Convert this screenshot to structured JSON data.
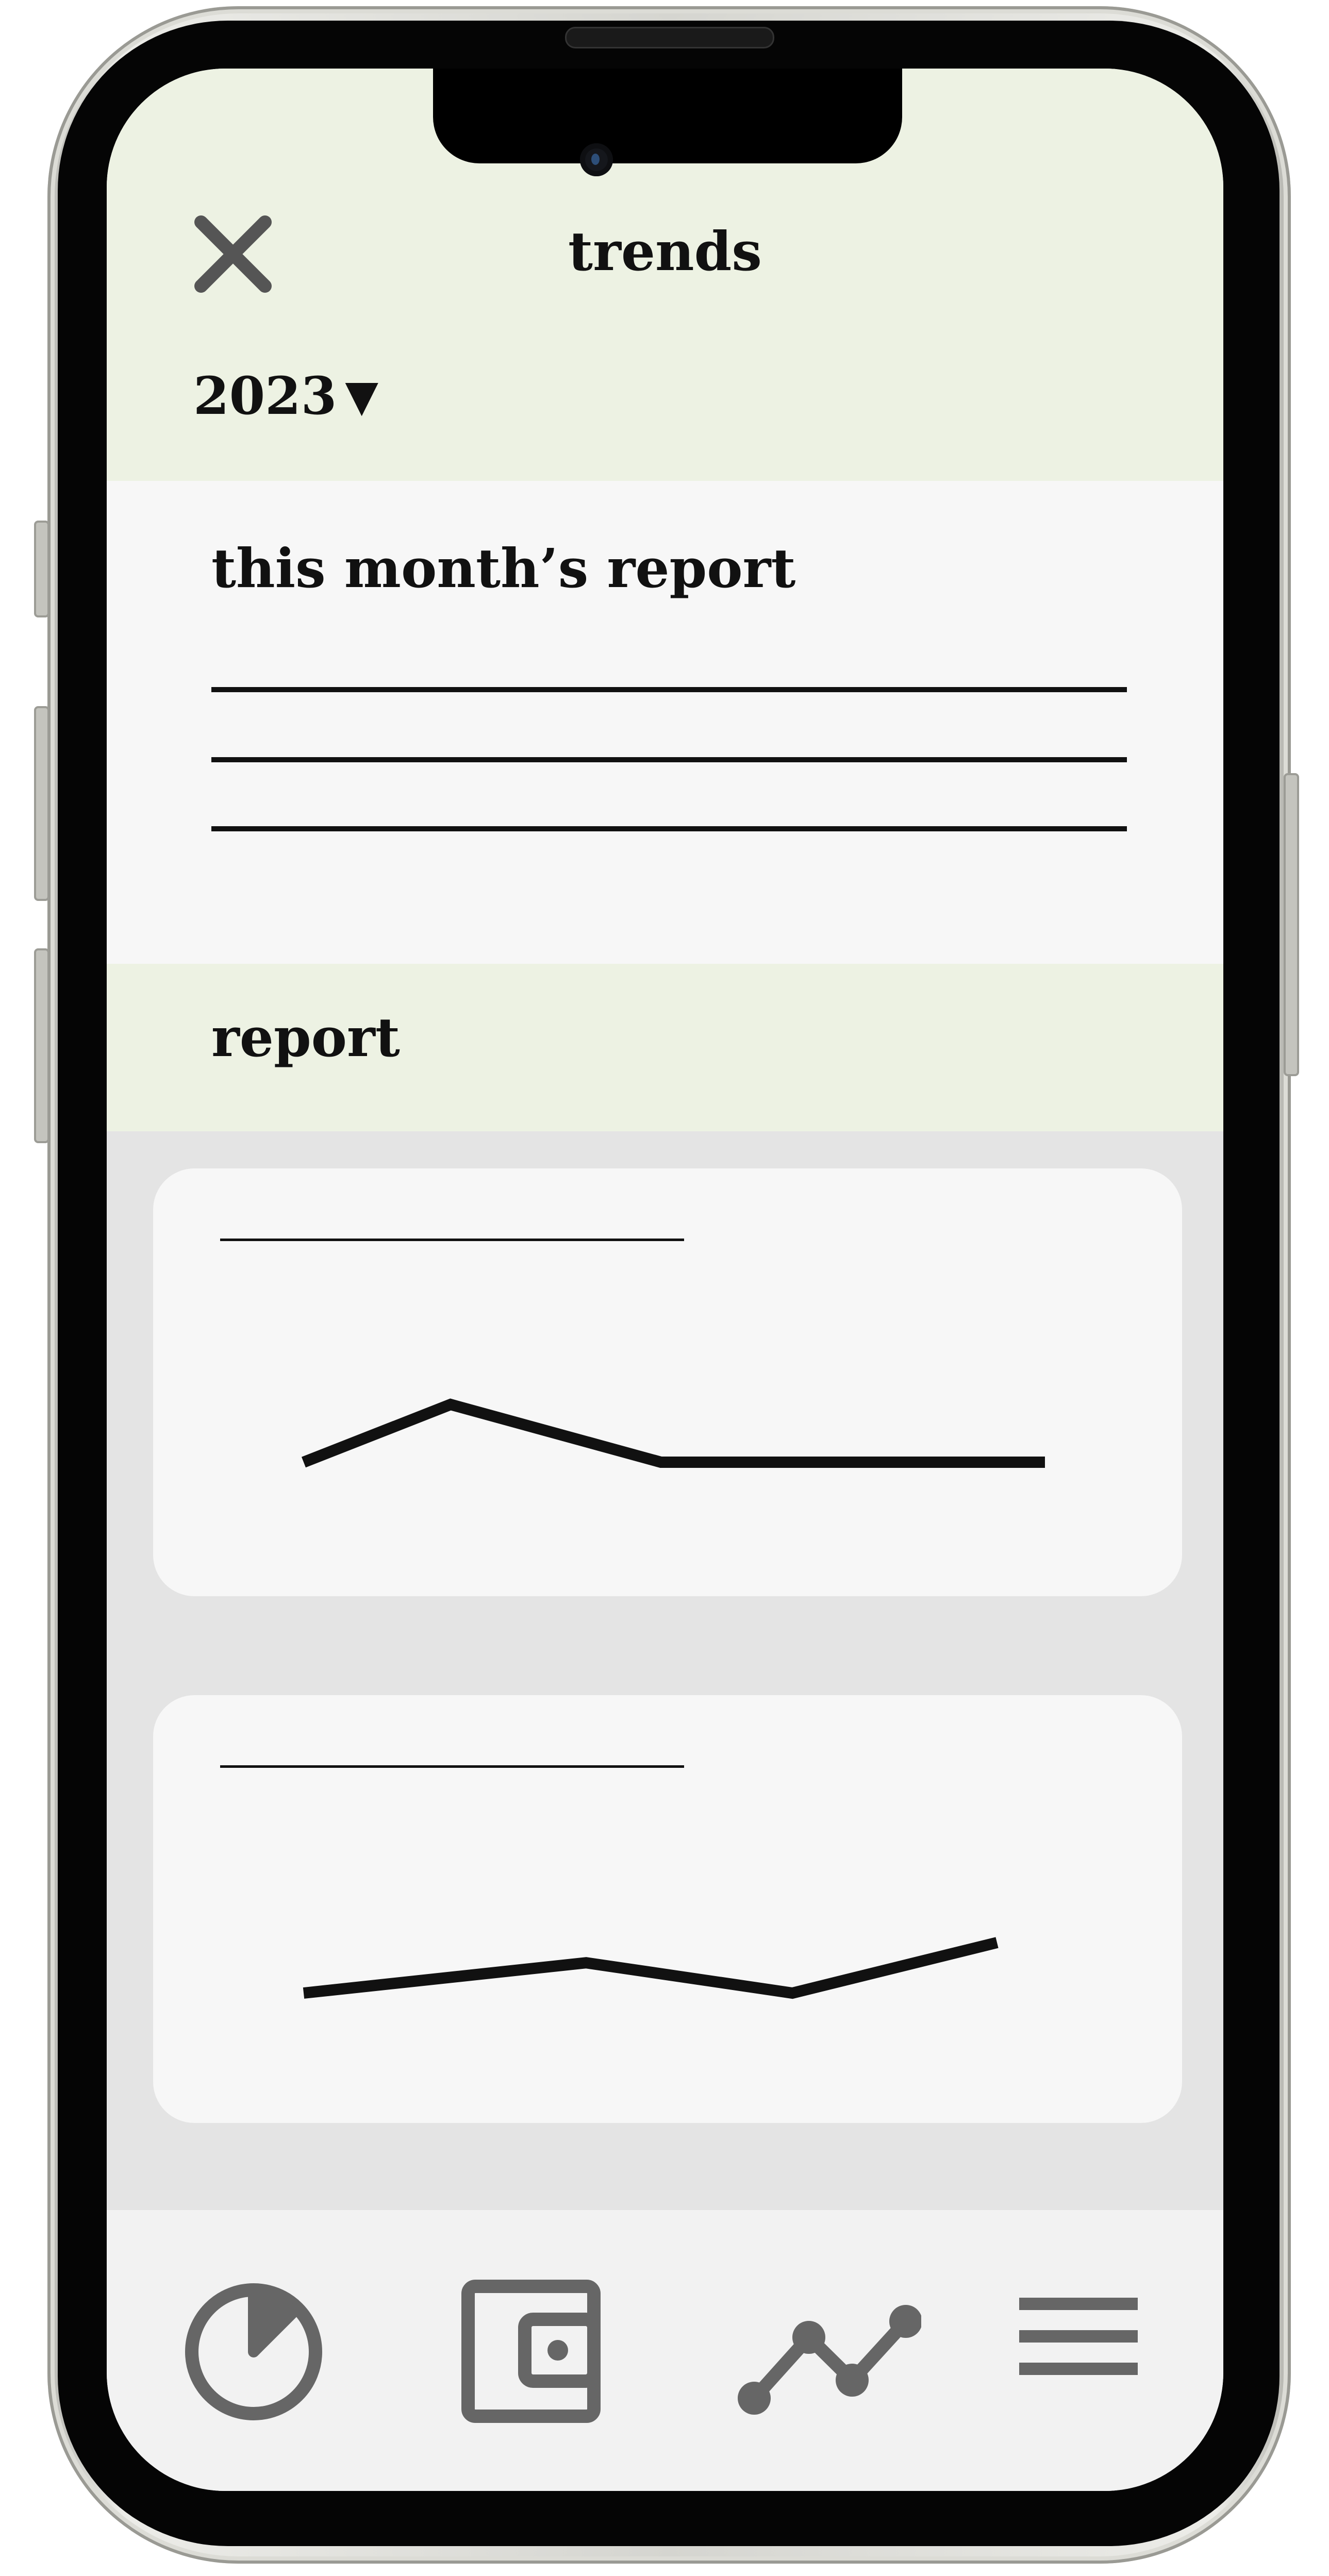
{
  "header": {
    "title": "trends",
    "close_icon": "close-icon",
    "year": "2023",
    "year_caret": "▼"
  },
  "monthly_report": {
    "heading": "this month’s report"
  },
  "report_section": {
    "heading": "report"
  },
  "cards": [
    {
      "chart_data": {
        "type": "line",
        "x": [
          1,
          2,
          3,
          4
        ],
        "values": [
          1.0,
          2.0,
          1.0,
          1.0
        ]
      }
    },
    {
      "chart_data": {
        "type": "line",
        "x": [
          1,
          2,
          3,
          4
        ],
        "values": [
          1.0,
          1.6,
          1.0,
          2.0
        ]
      }
    }
  ],
  "bottom_nav": {
    "items": [
      {
        "icon": "pie-chart-icon"
      },
      {
        "icon": "wallet-icon"
      },
      {
        "icon": "trend-line-icon"
      },
      {
        "icon": "menu-icon"
      }
    ],
    "icon_color": "#666666"
  },
  "colors": {
    "header_bg": "#edf2e3",
    "panel_bg": "#f7f7f7",
    "cards_bg": "#e4e4e4",
    "nav_bg": "#f2f2f2",
    "ink": "#111111"
  }
}
